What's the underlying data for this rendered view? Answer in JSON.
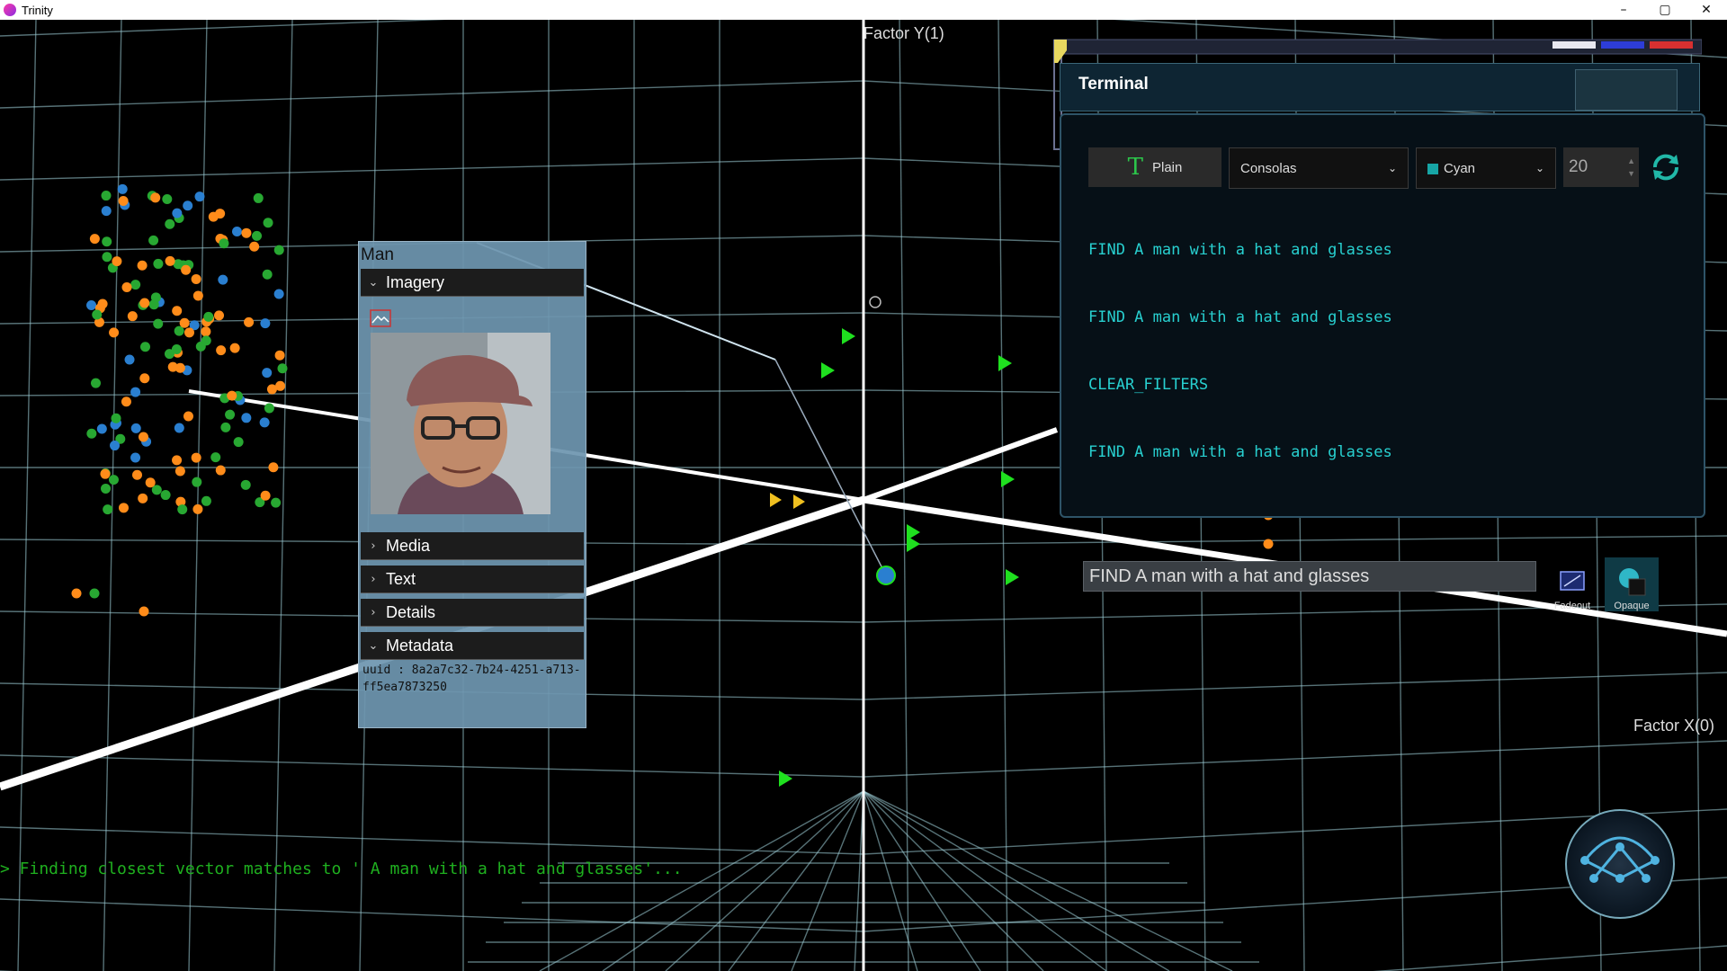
{
  "app": {
    "title": "Trinity"
  },
  "window_controls": {
    "minimize": "–",
    "maximize": "▢",
    "close": "✕"
  },
  "scene": {
    "axis_y_label": "Factor Y(1)",
    "axis_x_label": "Factor X(0)",
    "status_line": "> Finding closest vector matches to ' A man with a hat and glasses'..."
  },
  "info_panel": {
    "title": "Man",
    "sections": {
      "imagery": "Imagery",
      "media": "Media",
      "text": "Text",
      "details": "Details",
      "metadata": "Metadata"
    },
    "metadata_text": "uuid : 8a2a7c32-7b24-4251-a713-ff5ea7873250"
  },
  "terminal": {
    "title": "Terminal",
    "mode_label": "Plain",
    "font": "Consolas",
    "color": "Cyan",
    "font_size": "20",
    "history": [
      "FIND A man with a hat and glasses",
      "FIND A man with a hat and glasses",
      "CLEAR_FILTERS",
      "FIND A man with a hat and glasses"
    ],
    "input_value": "FIND A man with a hat and glasses",
    "fadeout_label": "Fadeout",
    "opaque_label": "Opaque"
  },
  "colors": {
    "orange_points": "#ff8c1a",
    "green_points": "#28a832",
    "blue_points": "#2a7fd0",
    "match_markers": "#1fe01f",
    "terminal_text": "#28d0d0",
    "status_text": "#1fb01f"
  }
}
